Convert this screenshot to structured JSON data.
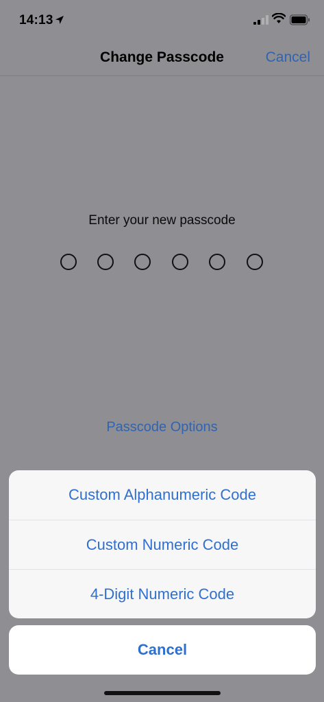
{
  "status": {
    "time": "14:13",
    "icons": [
      "location-arrow-icon",
      "cellular-signal-icon",
      "wifi-icon",
      "battery-icon"
    ]
  },
  "nav": {
    "title": "Change Passcode",
    "cancel_label": "Cancel"
  },
  "passcode": {
    "prompt": "Enter your new passcode",
    "digits_total": 6,
    "digits_entered": 0
  },
  "options_link": "Passcode Options",
  "action_sheet": {
    "items": [
      {
        "label": "Custom Alphanumeric Code"
      },
      {
        "label": "Custom Numeric Code"
      },
      {
        "label": "4-Digit Numeric Code"
      }
    ],
    "cancel_label": "Cancel"
  },
  "colors": {
    "accent": "#2f6fcf",
    "dimmed_background": "#8e8e93",
    "sheet_background": "#f7f7f8"
  }
}
